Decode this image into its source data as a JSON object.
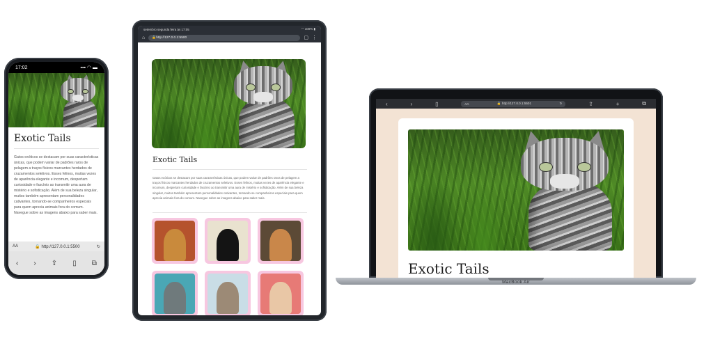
{
  "site": {
    "title": "Exotic Tails",
    "intro": "Gatos exóticos se destacam por suas características únicas, que podem variar de padrões raros de pelagem a traços físicos marcantes herdados de cruzamentos seletivos. Esses felinos, muitas vezes de aparência elegante e incomum, despertam curiosidade e fascínio ao transmitir uma aura de mistério e sofisticação. Além de sua beleza singular, muitos também apresentam personalidades cativantes, tornando-se companheiros especiais para quem aprecia animais fora do comum. Navegue sobre as imagens abaixo para saber mais.",
    "url_phone": "http://127.0.0.1:5500",
    "url_tablet": "http://127.0.0.1:5500",
    "url_laptop": "http://127.0.0.1:5501"
  },
  "phone": {
    "time": "17:02",
    "signal": "▪▪▪ ◠ ▬",
    "aa_label": "AA"
  },
  "tablet": {
    "status_left": "setembro segunda feira às 17:05",
    "status_right": "◠ 100% ▮"
  },
  "laptop": {
    "model_label": "MacBook Air",
    "aa_label": "AA"
  },
  "gallery": [
    {
      "name": "bengal-cat",
      "bg": "#b5532d",
      "fur": "#c98a3c"
    },
    {
      "name": "black-cat",
      "bg": "#e9e2cf",
      "fur": "#141414"
    },
    {
      "name": "caracal-cat",
      "bg": "#5c4a36",
      "fur": "#c9874a"
    },
    {
      "name": "grey-cat",
      "bg": "#4aa7b5",
      "fur": "#6f7a7c"
    },
    {
      "name": "tabby-cat",
      "bg": "#c9dde6",
      "fur": "#9c8a76"
    },
    {
      "name": "sphynx-cat",
      "bg": "#e77a76",
      "fur": "#e9c7a6"
    }
  ]
}
